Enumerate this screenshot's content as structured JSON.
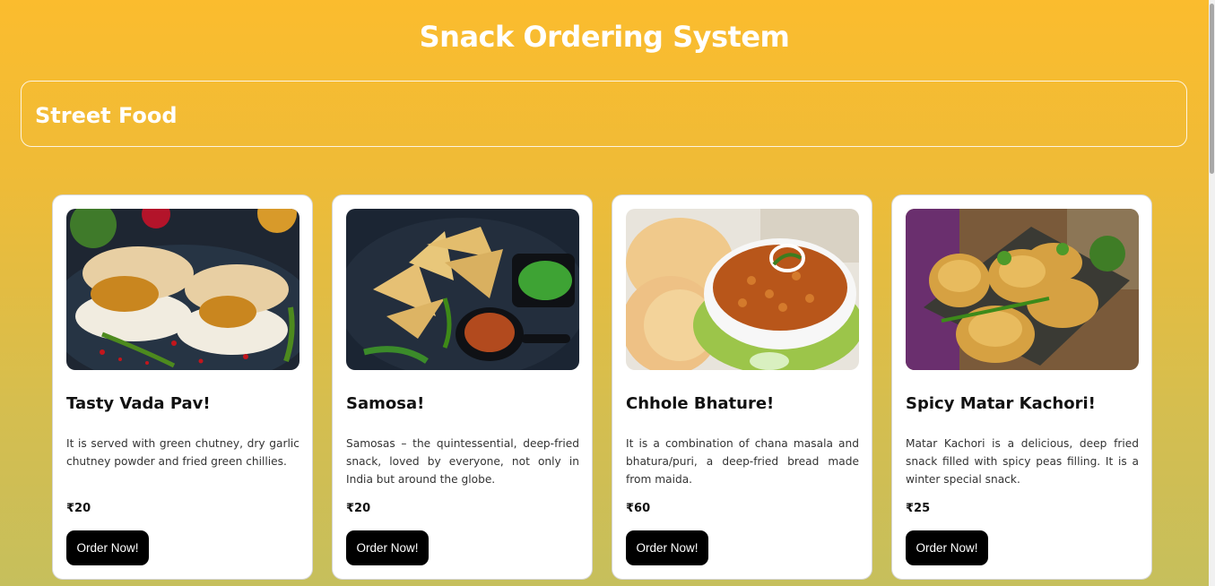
{
  "header": {
    "title": "Snack Ordering System"
  },
  "category": {
    "title": "Street Food"
  },
  "cards": [
    {
      "image_alt": "vada-pav-photo",
      "title": "Tasty Vada Pav!",
      "description": "It is served with green chutney, dry garlic chutney powder and fried green chillies.",
      "price": "₹20",
      "button_label": "Order Now!"
    },
    {
      "image_alt": "samosa-photo",
      "title": "Samosa!",
      "description": "Samosas – the quintessential, deep-fried snack, loved by everyone, not only in India but around the globe.",
      "price": "₹20",
      "button_label": "Order Now!"
    },
    {
      "image_alt": "chhole-bhature-photo",
      "title": "Chhole Bhature!",
      "description": "It is a combination of chana masala and bhatura/puri, a deep-fried bread made from maida.",
      "price": "₹60",
      "button_label": "Order Now!"
    },
    {
      "image_alt": "matar-kachori-photo",
      "title": "Spicy Matar Kachori!",
      "description": "Matar Kachori is a delicious, deep fried snack filled with spicy peas filling. It is a winter special snack.",
      "price": "₹25",
      "button_label": "Order Now!"
    }
  ]
}
